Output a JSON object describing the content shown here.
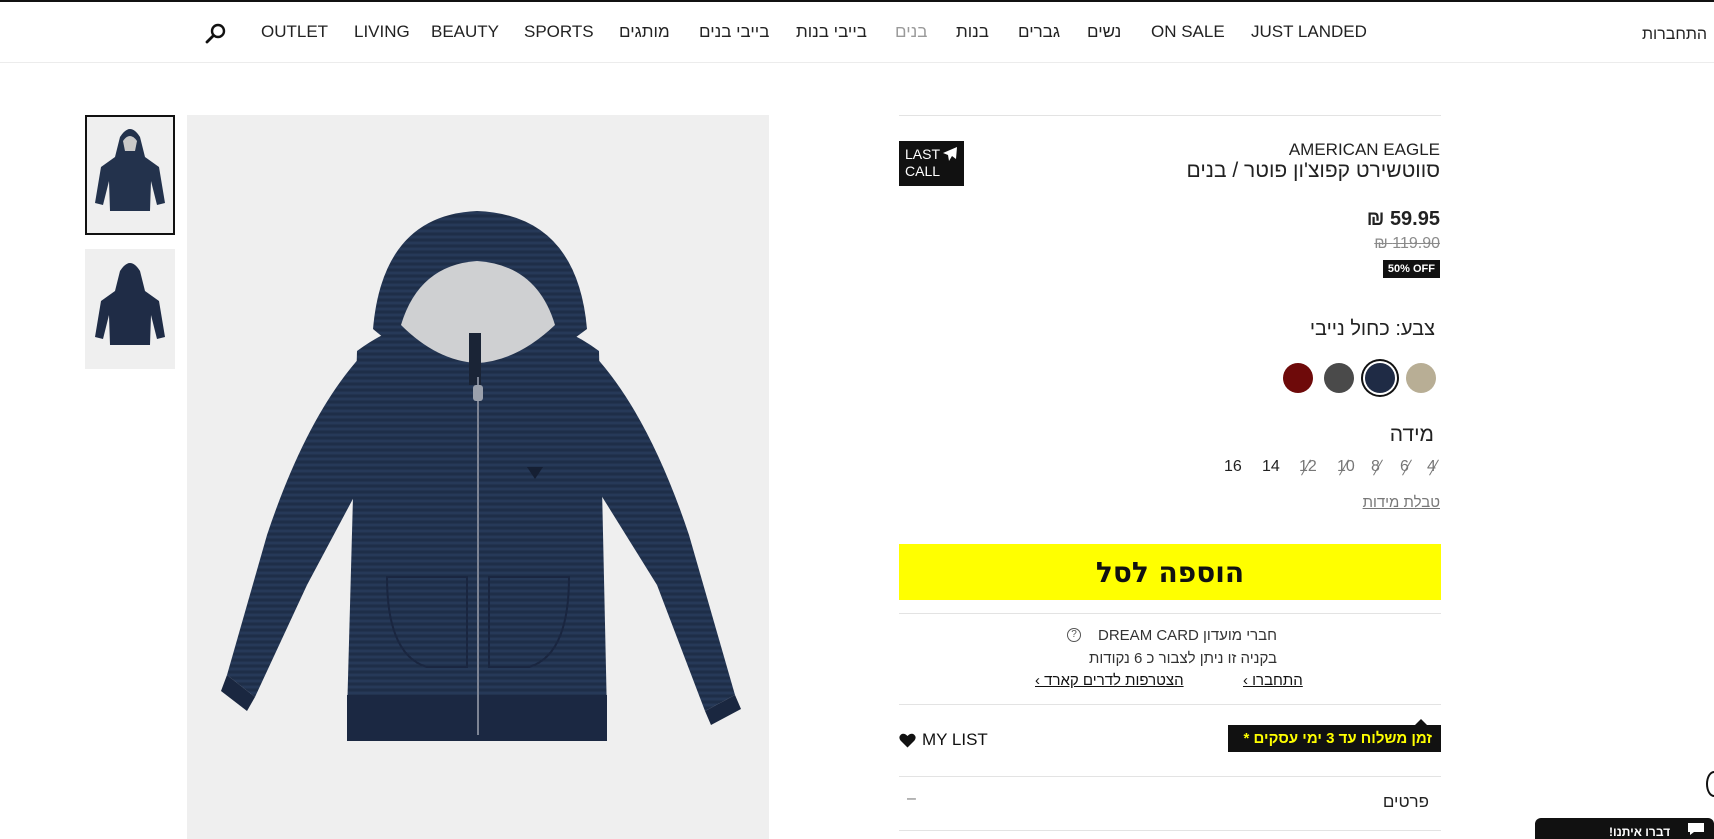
{
  "nav": {
    "login": "התחברות",
    "items": [
      "JUST LANDED",
      "ON SALE",
      "נשים",
      "גברים",
      "בנות",
      "בנים",
      "בייבי בנות",
      "בייבי בנים",
      "מותגים",
      "SPORTS",
      "BEAUTY",
      "LIVING",
      "OUTLET"
    ],
    "active_item": "בנים",
    "search_icon": "search-icon"
  },
  "product": {
    "badge_line1": "LAST",
    "badge_line2": "CALL",
    "badge_icon": "plane-icon",
    "brand": "AMERICAN EAGLE",
    "title": "סווטשירט קפוצ'ון פוטר / בנים",
    "price": "59.95 ₪",
    "old_price": "119.90 ₪",
    "discount": "50% OFF",
    "color_label": "צבע: כחול נייבי",
    "colors": [
      {
        "name": "beige",
        "hex": "#b8ae95",
        "selected": false
      },
      {
        "name": "navy",
        "hex": "#1f2b45",
        "selected": true
      },
      {
        "name": "charcoal",
        "hex": "#4a4a4a",
        "selected": false
      },
      {
        "name": "burgundy",
        "hex": "#6e0a0a",
        "selected": false
      }
    ],
    "size_label": "מידה",
    "sizes": [
      {
        "label": "4",
        "available": false
      },
      {
        "label": "6",
        "available": false
      },
      {
        "label": "8",
        "available": false
      },
      {
        "label": "10",
        "available": false
      },
      {
        "label": "12",
        "available": false
      },
      {
        "label": "14",
        "available": true
      },
      {
        "label": "16",
        "available": true
      }
    ],
    "size_table": "טבלת מידות",
    "add_to_cart": "הוספה לסל"
  },
  "club": {
    "line1": "חברי מועדון DREAM CARD",
    "line2": "בקניה זו ניתן לצבור כ 6 נקודות",
    "login_link": "התחברו ›",
    "join_link": "הצטרפות לדרים קארד ›"
  },
  "actions": {
    "mylist": "MY LIST",
    "shipping": "זמן משלוח עד 3 ימי עסקים *"
  },
  "details": {
    "label": "פרטים",
    "toggle": "–"
  },
  "chat": {
    "label": "דברו איתנו!"
  }
}
